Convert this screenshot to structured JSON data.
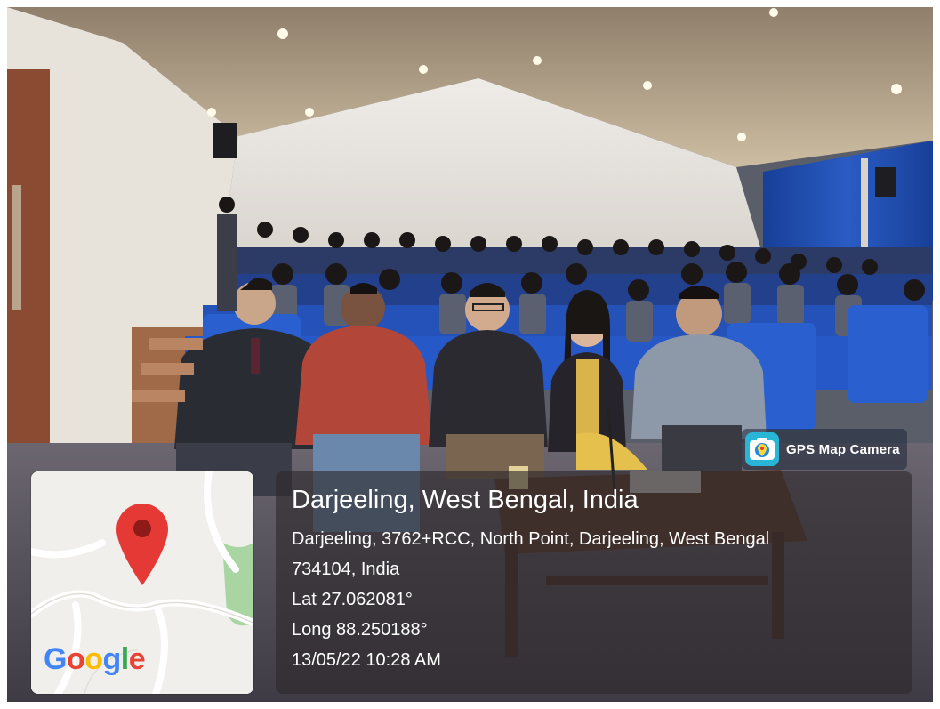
{
  "badge": {
    "icon": "gps-map-camera-app-icon",
    "label": "GPS Map Camera"
  },
  "map": {
    "pin_icon": "location-pin-icon",
    "pin_color": "#e53935",
    "logo_text": [
      "G",
      "o",
      "o",
      "g",
      "l",
      "e"
    ]
  },
  "location": {
    "title": "Darjeeling, West Bengal, India",
    "address_line1": "Darjeeling, 3762+RCC, North Point, Darjeeling, West Bengal",
    "address_line2": "734104, India",
    "latitude": "Lat 27.062081°",
    "longitude": "Long 88.250188°",
    "datetime": "13/05/22 10:28 AM"
  },
  "scene": {
    "description_colors": {
      "curtain": "#1f4fb0",
      "seat": "#2457c5",
      "wall": "#e4e0dc",
      "ceiling": "#c8b69a"
    }
  }
}
